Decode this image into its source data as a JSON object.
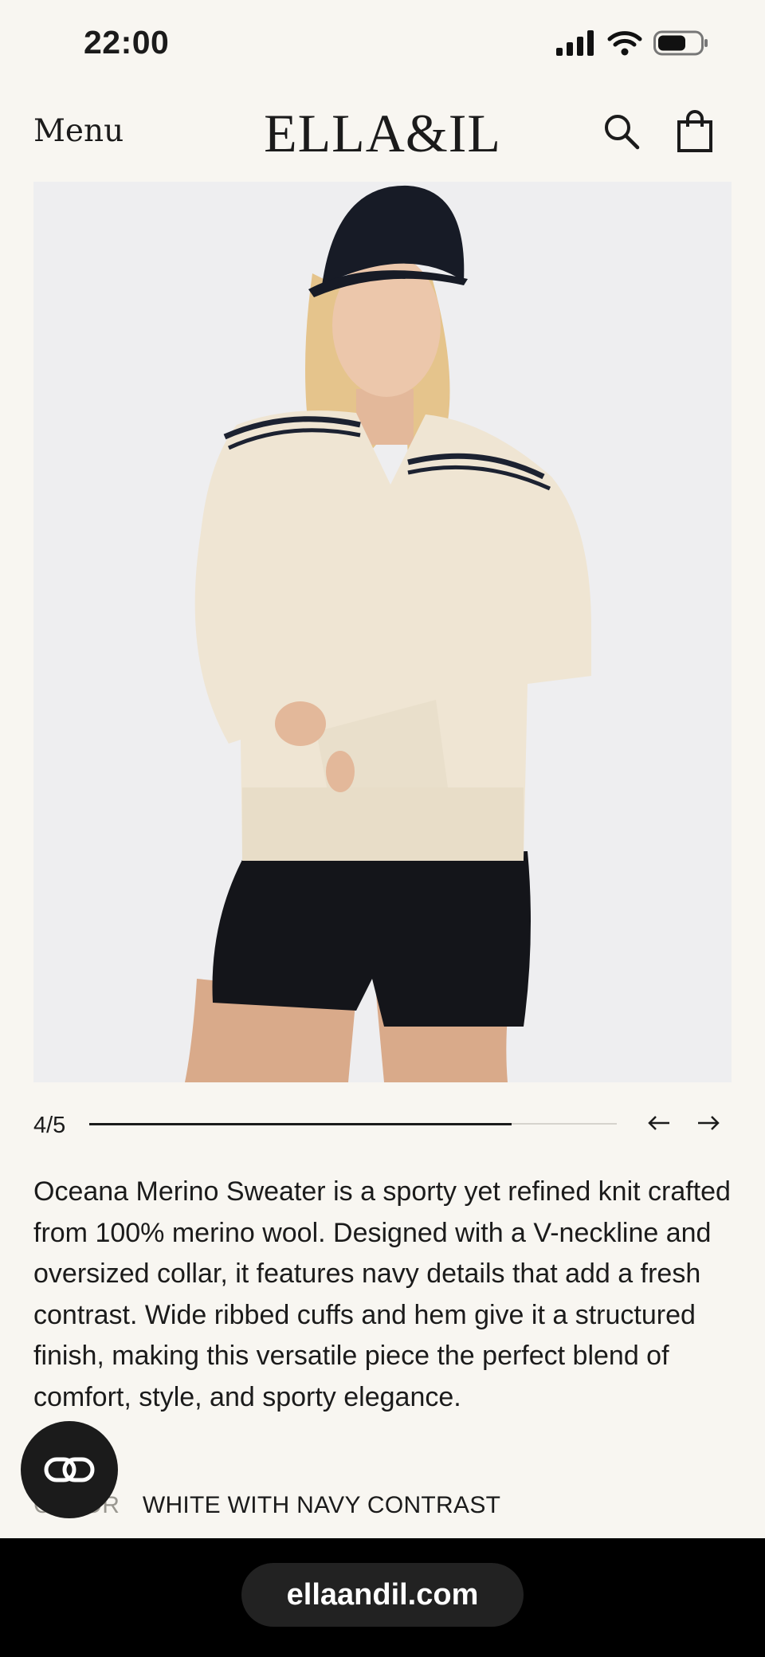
{
  "status_bar": {
    "time": "22:00"
  },
  "header": {
    "menu_label": "Menu",
    "logo_text": "ELLA&IL",
    "search_icon": "search-icon",
    "bag_icon": "shopping-bag-icon"
  },
  "gallery": {
    "counter": "4/5",
    "current": 4,
    "total": 5,
    "progress_fraction": 0.8,
    "prev_icon": "arrow-left-icon",
    "next_icon": "arrow-right-icon"
  },
  "product": {
    "description": "Oceana Merino Sweater is a sporty yet refined knit crafted from 100% merino wool. Designed with a V-neckline and oversized collar, it features navy details that add a fresh contrast. Wide ribbed cuffs and hem give it a structured finish, making this versatile piece the perfect blend of comfort, style, and sporty elegance.",
    "color_label": "COLOR",
    "color_value": "WHITE WITH NAVY CONTRAST"
  },
  "browser": {
    "url": "ellaandil.com"
  },
  "colors": {
    "background": "#f8f6f1",
    "text": "#1b1b1b",
    "sweater": "#efe5d3",
    "navy": "#1c2231"
  }
}
